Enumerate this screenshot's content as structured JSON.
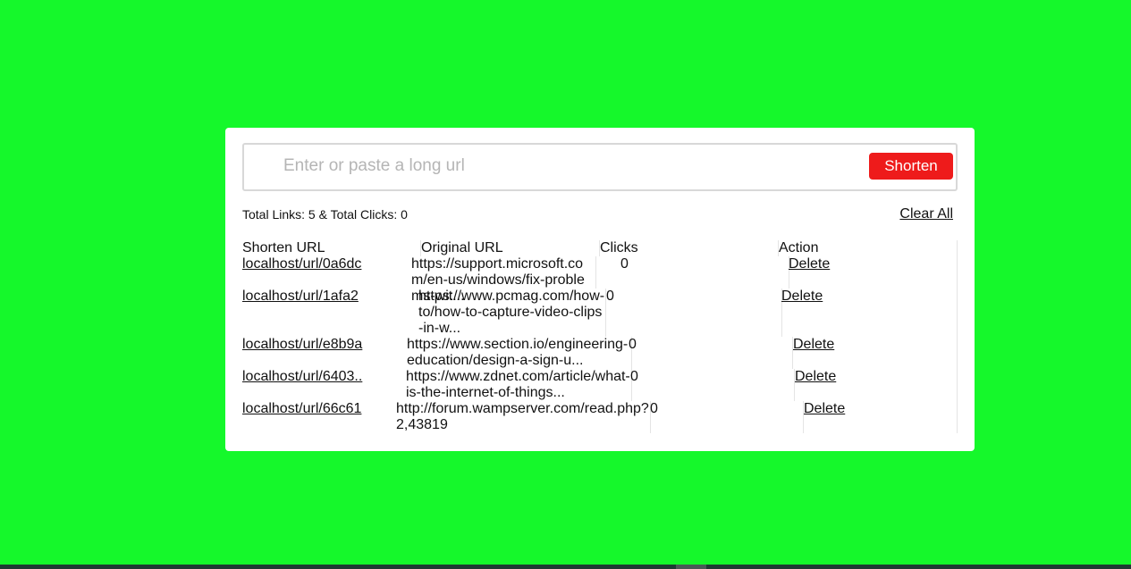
{
  "shortener": {
    "input_placeholder": "Enter or paste a long url",
    "input_value": "",
    "shorten_label": "Shorten",
    "totals_text": "Total Links: 5 & Total Clicks: 0",
    "clear_all_label": "Clear All"
  },
  "table": {
    "headers": [
      "Shorten URL",
      "Original URL",
      "Clicks",
      "Action"
    ],
    "rows": [
      {
        "short": "localhost/url/0a6dc",
        "original": "https://support.microsoft.com/en-us/windows/fix-problems-wit...",
        "clicks": "0",
        "action": "Delete"
      },
      {
        "short": "localhost/url/1afa2",
        "original": "https://www.pcmag.com/how-to/how-to-capture-video-clips-in-w...",
        "clicks": "0",
        "action": "Delete"
      },
      {
        "short": "localhost/url/e8b9a",
        "original": "https://www.section.io/engineering-education/design-a-sign-u...",
        "clicks": "0",
        "action": "Delete"
      },
      {
        "short": "localhost/url/6403..",
        "original": "https://www.zdnet.com/article/what-is-the-internet-of-things...",
        "clicks": "0",
        "action": "Delete"
      },
      {
        "short": "localhost/url/66c61",
        "original": "http://forum.wampserver.com/read.php?2,43819",
        "clicks": "0",
        "action": "Delete"
      }
    ]
  },
  "colors": {
    "background": "#15f82b",
    "card": "#ffffff",
    "accent_button": "#ee1b1b"
  }
}
